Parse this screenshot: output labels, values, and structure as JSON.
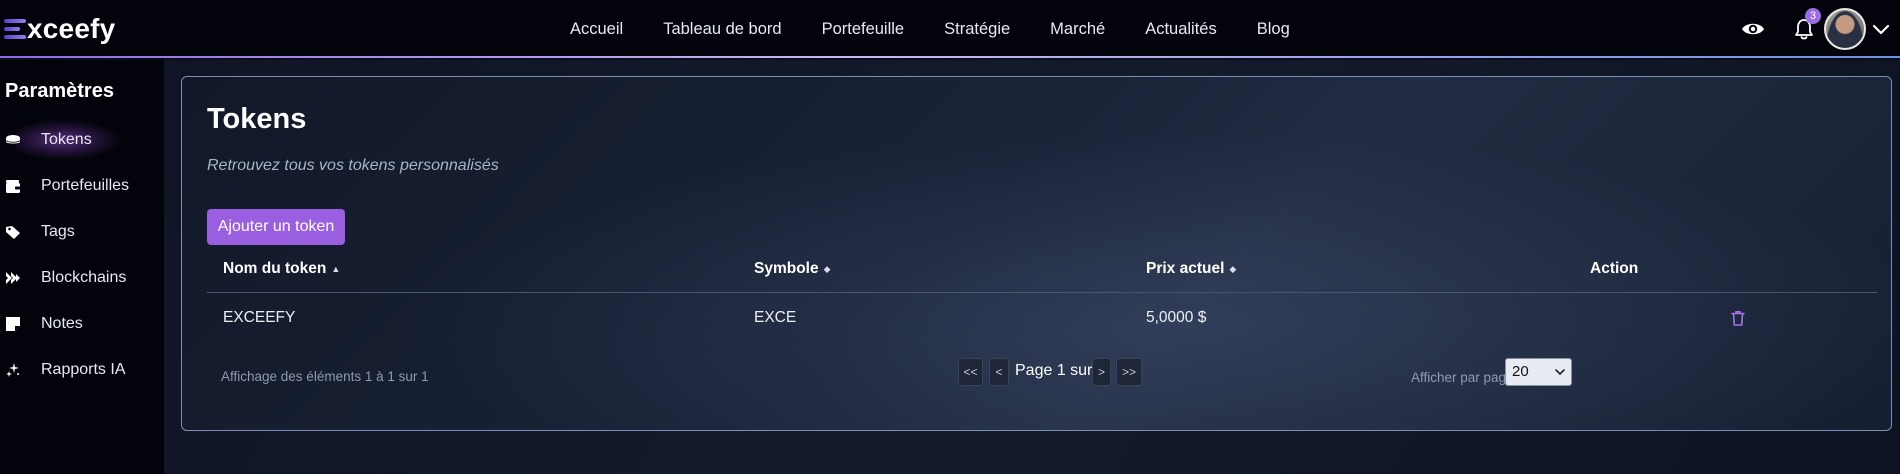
{
  "header": {
    "logo_text": "xceefy",
    "nav": [
      "Accueil",
      "Tableau de bord",
      "Portefeuille",
      "Stratégie",
      "Marché",
      "Actualités",
      "Blog"
    ],
    "notification_count": "3"
  },
  "sidebar": {
    "title": "Paramètres",
    "items": [
      {
        "label": "Tokens",
        "icon": "coins-icon",
        "active": true
      },
      {
        "label": "Portefeuilles",
        "icon": "wallet-icon"
      },
      {
        "label": "Tags",
        "icon": "tags-icon"
      },
      {
        "label": "Blockchains",
        "icon": "blockchain-icon"
      },
      {
        "label": "Notes",
        "icon": "note-icon"
      },
      {
        "label": "Rapports IA",
        "icon": "sparkles-icon"
      }
    ]
  },
  "main": {
    "title": "Tokens",
    "subtitle": "Retrouvez tous vos tokens personnalisés",
    "add_button": "Ajouter un token",
    "columns": [
      "Nom du token",
      "Symbole",
      "Prix actuel",
      "Action"
    ],
    "rows": [
      {
        "name": "EXCEEFY",
        "symbol": "EXCE",
        "price": "5,0000 $"
      }
    ],
    "footer_info": "Affichage des éléments 1 à 1 sur 1",
    "pager": {
      "first": "<<",
      "prev": "<",
      "text": "Page 1 sur 1",
      "next": ">",
      "last": ">>"
    },
    "per_page_label": "Afficher par page",
    "per_page_value": "20"
  },
  "colors": {
    "accent": "#9a5fe0",
    "background": "#0b0f1c",
    "topbar": "#03040b"
  }
}
